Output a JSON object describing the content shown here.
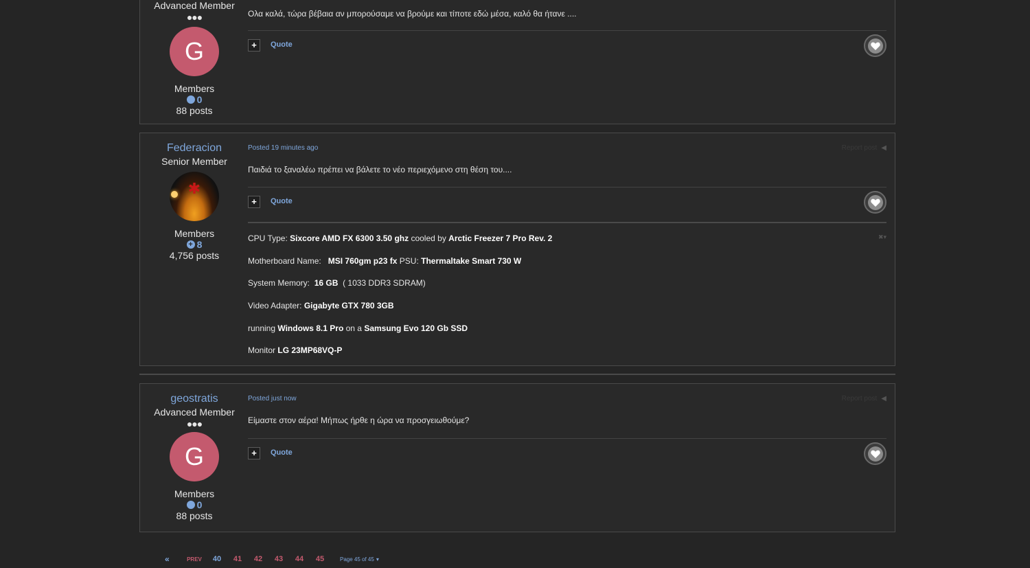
{
  "posts": [
    {
      "author_title": "Advanced Member",
      "rank_dots": "●●●",
      "avatar_letter": "G",
      "group": "Members",
      "reputation": "0",
      "post_count": "88 posts",
      "text": "Ολα καλά, τώρα βέβαια αν μπορούσαμε να βρούμε και τίποτε εδώ μέσα, καλό θα ήτανε ....",
      "quote_label": "Quote",
      "plus_label": "+"
    },
    {
      "author_name": "Federacion",
      "author_title": "Senior Member",
      "group": "Members",
      "reputation": "8",
      "post_count": "4,756 posts",
      "posted": "Posted 19 minutes ago",
      "report_label": "Report post",
      "text": "Παιδιά το ξαναλέω πρέπει να βάλετε το νέο περιεχόμενο στη θέση του....",
      "quote_label": "Quote",
      "plus_label": "+",
      "signature": {
        "line1": {
          "a": "CPU Type: ",
          "b": "Sixcore AMD FX 6300 3.50 ghz",
          "c": " cooled by ",
          "d": "Arctic Freezer 7 Pro Rev. 2"
        },
        "line2": {
          "a": "Motherboard Name: ",
          "b": "MSI 760gm p23 fx",
          "c": " PSU: ",
          "d": "Thermaltake Smart 730 W"
        },
        "line3": {
          "a": "System Memory: ",
          "b": "16 GB",
          "c": " ( 1033 DDR3 SDRAM)"
        },
        "line4": {
          "a": "Video Adapter: ",
          "b": "Gigabyte GTX 780 3GB"
        },
        "line5": {
          "a": "running ",
          "b": "Windows 8.1 Pro",
          "c": " on a ",
          "d": "Samsung Evo 120 Gb SSD"
        },
        "line6": {
          "a": "Monitor ",
          "b": "LG 23MP68VQ-P"
        }
      }
    },
    {
      "author_name": "geostratis",
      "author_title": "Advanced Member",
      "rank_dots": "●●●",
      "avatar_letter": "G",
      "group": "Members",
      "reputation": "0",
      "post_count": "88 posts",
      "posted": "Posted just now",
      "report_label": "Report post",
      "text": "Είμαστε στον αέρα!  Μήπως ήρθε η ώρα να προσγειωθούμε?",
      "quote_label": "Quote",
      "plus_label": "+"
    }
  ],
  "pagination": {
    "first": "«",
    "prev": "PREV",
    "pages": [
      "40",
      "41",
      "42",
      "43",
      "44",
      "45"
    ],
    "current": "40",
    "jump_label": "Page 45 of 45",
    "caret": "▾"
  },
  "colors": {
    "background": "#252525",
    "link": "#7fa7dc",
    "avatar_g": "#c45a6e"
  }
}
